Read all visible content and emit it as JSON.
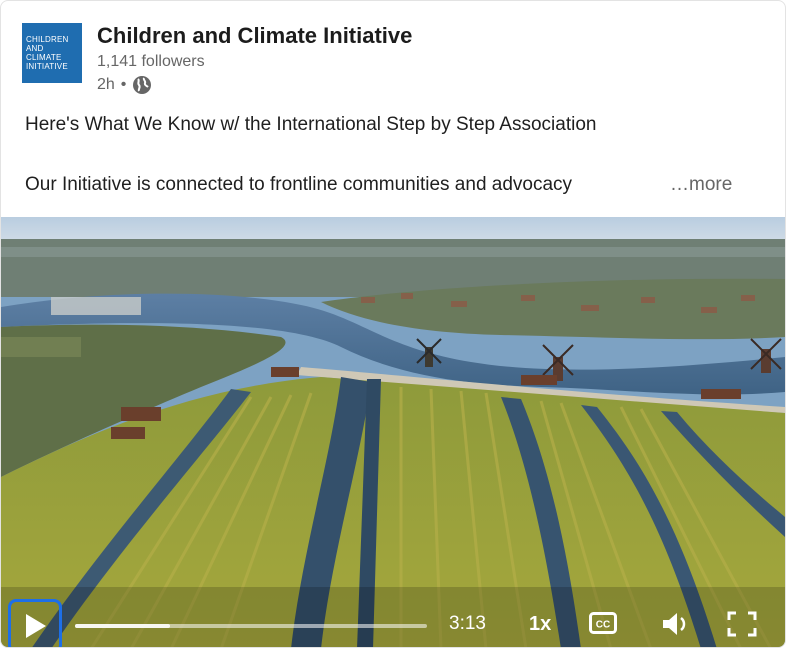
{
  "post": {
    "org_logo_text": "CHILDREN AND CLIMATE INITIATIVE",
    "org_name": "Children and Climate Initiative",
    "followers": "1,141 followers",
    "time": "2h",
    "separator": "•",
    "visibility_icon": "globe-icon",
    "text_line1": "Here's What We Know w/ the International Step by Step Association",
    "text_line2": "Our Initiative is connected to frontline communities and advocacy",
    "more_label": "…more"
  },
  "video": {
    "duration": "3:13",
    "speed": "1x",
    "progress": 0.0,
    "buffered": 0.27,
    "icons": [
      "play-icon",
      "captions-icon",
      "volume-icon",
      "fullscreen-icon"
    ]
  },
  "colors": {
    "logo_bg": "#1f6db0",
    "focus_ring": "#1d6fe8",
    "muted_text": "#666666"
  }
}
